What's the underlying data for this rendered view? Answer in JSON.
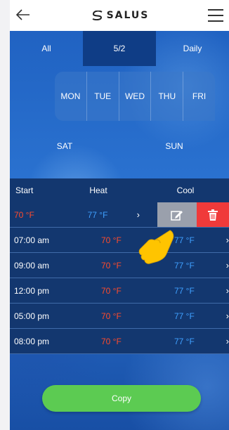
{
  "header": {
    "brand": "SALUS",
    "back_icon": "arrow-left-icon",
    "menu_icon": "hamburger-menu-icon"
  },
  "modes": [
    {
      "label": "All",
      "active": false
    },
    {
      "label": "5/2",
      "active": true
    },
    {
      "label": "Daily",
      "active": false
    }
  ],
  "days_weekdays": [
    "MON",
    "TUE",
    "WED",
    "THU",
    "FRI"
  ],
  "days_weekend": [
    "SAT",
    "SUN"
  ],
  "table": {
    "headers": {
      "start": "Start",
      "heat": "Heat",
      "cool": "Cool"
    },
    "swiped_row": {
      "heat": "70 °F",
      "cool": "77 °F"
    },
    "rows": [
      {
        "time": "07:00 am",
        "heat": "70 °F",
        "cool": "77 °F"
      },
      {
        "time": "09:00 am",
        "heat": "70 °F",
        "cool": "77 °F"
      },
      {
        "time": "12:00 pm",
        "heat": "70 °F",
        "cool": "77 °F"
      },
      {
        "time": "05:00 pm",
        "heat": "70 °F",
        "cool": "77 °F"
      },
      {
        "time": "08:00 pm",
        "heat": "70 °F",
        "cool": "77 °F"
      }
    ]
  },
  "actions": {
    "edit_icon": "edit-icon",
    "delete_icon": "trash-icon"
  },
  "copy_label": "Copy",
  "colors": {
    "heat": "#ff4b2b",
    "cool": "#3fa0ff",
    "copy": "#5ccb52",
    "delete": "#f03a3a",
    "edit": "#9aa0ac"
  }
}
